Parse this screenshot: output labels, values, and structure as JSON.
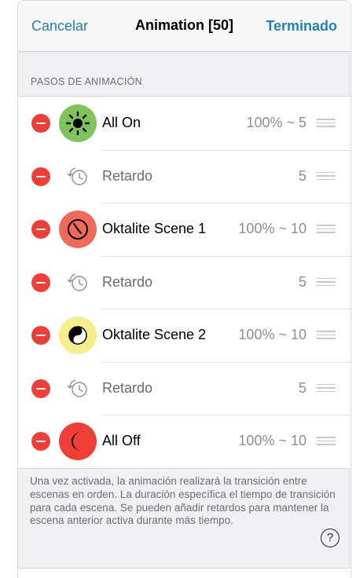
{
  "nav": {
    "cancel": "Cancelar",
    "title": "Animation [50]",
    "done": "Terminado"
  },
  "section_header": "PASOS DE ANIMACIÓN",
  "steps": [
    {
      "label": "All On",
      "value": "100% ~ 5",
      "icon": "sun-icon",
      "color": "#7ec45a"
    },
    {
      "label": "Retardo",
      "value": "5",
      "icon": "delay-icon"
    },
    {
      "label": "Oktalite Scene 1",
      "value": "100% ~ 10",
      "icon": "clock-icon",
      "color": "#ef6a58"
    },
    {
      "label": "Retardo",
      "value": "5",
      "icon": "delay-icon"
    },
    {
      "label": "Oktalite Scene 2",
      "value": "100% ~ 10",
      "icon": "yin-yang-icon",
      "color": "#f4ef8c"
    },
    {
      "label": "Retardo",
      "value": "5",
      "icon": "delay-icon"
    },
    {
      "label": "All Off",
      "value": "100% ~ 10",
      "icon": "moon-icon",
      "color": "#ef3e36"
    }
  ],
  "footer_text": "Una vez activada, la animación realizará la transición entre escenas en orden. La duración específica el tiempo de transición para cada escena. Se pueden añadir retardos para mantener la escena anterior activa durante más tiempo.",
  "help_label": "?"
}
